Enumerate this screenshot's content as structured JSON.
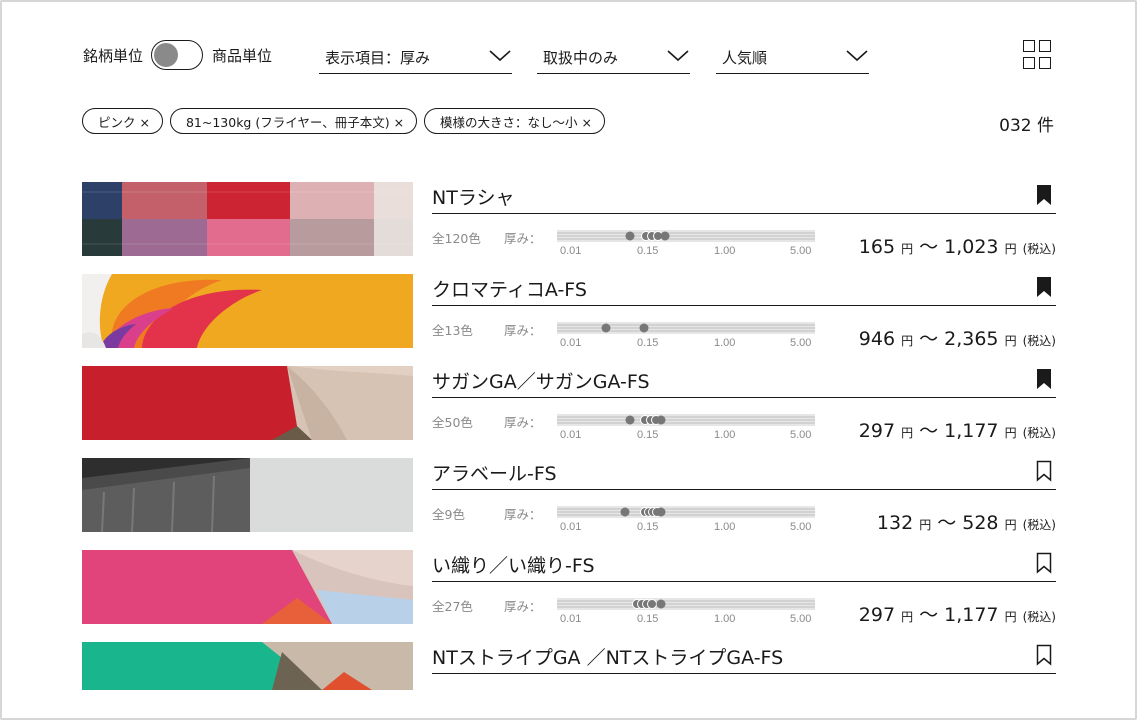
{
  "toolbar": {
    "unit_left": "銘柄単位",
    "unit_right": "商品単位",
    "display_item": "表示項目：厚み",
    "availability": "取扱中のみ",
    "sort": "人気順"
  },
  "filters": [
    "ピンク ×",
    "81~130kg (フライヤー、冊子本文) ×",
    "模様の大きさ：なし～小 ×"
  ],
  "result_count": "032 件",
  "scale_ticks": [
    "0.01",
    "0.15",
    "1.00",
    "5.00"
  ],
  "labels": {
    "thickness": "厚み：",
    "yen": "円",
    "tilde": "～",
    "tax": "(税込)"
  },
  "icons": {
    "bookmark_filled": "bookmark-filled-icon",
    "bookmark_outline": "bookmark-outline-icon",
    "grid": "grid-view-icon",
    "chevron": "chevron-down-icon"
  },
  "products": [
    {
      "name": "NTラシャ",
      "colors": "全120色",
      "price_min": "165",
      "price_max": "1,023",
      "bookmarked": true
    },
    {
      "name": "クロマティコA-FS",
      "colors": "全13色",
      "price_min": "946",
      "price_max": "2,365",
      "bookmarked": true
    },
    {
      "name": "サガンGA／サガンGA-FS",
      "colors": "全50色",
      "price_min": "297",
      "price_max": "1,177",
      "bookmarked": true
    },
    {
      "name": "アラベール-FS",
      "colors": "全9色",
      "price_min": "132",
      "price_max": "528",
      "bookmarked": false
    },
    {
      "name": "い織り／い織り-FS",
      "colors": "全27色",
      "price_min": "297",
      "price_max": "1,177",
      "bookmarked": false
    },
    {
      "name": "NTストライプGA ／NTストライプGA-FS",
      "bookmarked": false
    }
  ]
}
